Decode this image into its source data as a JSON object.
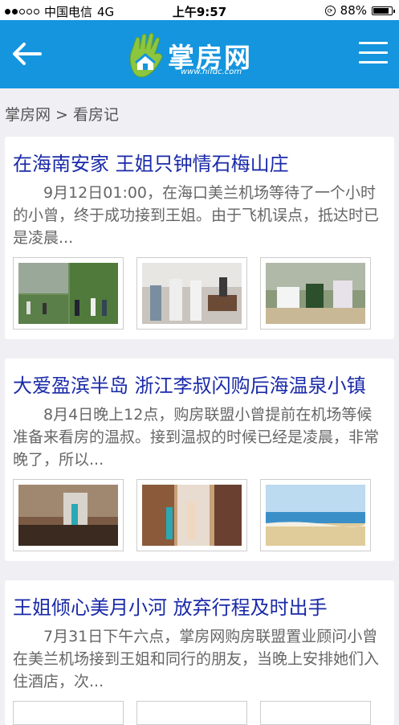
{
  "status": {
    "carrier": "中国电信",
    "network": "4G",
    "time": "上午9:57",
    "battery": "88%",
    "battery_level": 0.88
  },
  "header": {
    "logo_text": "掌房网",
    "logo_url": "www.hifdc.com",
    "colors": {
      "bar": "#1495de",
      "logo_green": "#8cc63f"
    }
  },
  "breadcrumb": {
    "home": "掌房网",
    "separator": ">",
    "current": "看房记"
  },
  "articles": [
    {
      "title": "在海南安家 王姐只钟情石梅山庄",
      "summary": "9月12日01:00，在海口美兰机场等待了一个小时的小曾，终于成功接到王姐。由于飞机误点，抵达时已是凌晨..."
    },
    {
      "title": "大爱盈滨半岛 浙江李叔闪购后海温泉小镇",
      "summary": "8月4日晚上12点，购房联盟小曾提前在机场等候准备来看房的温叔。接到温叔的时候已经是凌晨，非常晚了，所以..."
    },
    {
      "title": "王姐倾心美月小河 放弃行程及时出手",
      "summary": "7月31日下午六点，掌房网购房联盟置业顾问小曾在美兰机场接到王姐和同行的朋友，当晚上安排她们入住酒店，次..."
    }
  ]
}
